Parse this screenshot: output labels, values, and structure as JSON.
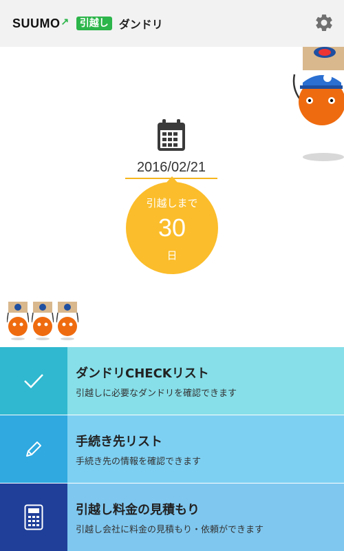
{
  "header": {
    "logo_suumo": "SUUMO",
    "logo_box": "引越し",
    "logo_text": "ダンドリ",
    "settings_icon": "gear-icon"
  },
  "countdown": {
    "date": "2016/02/21",
    "label": "引越しまで",
    "days": "30",
    "unit": "日"
  },
  "menu": [
    {
      "title": "ダンドリCHECKリスト",
      "subtitle": "引越しに必要なダンドリを確認できます",
      "icon": "check-icon",
      "icon_bg": "#2fb8cf",
      "bg": "#86dfe9"
    },
    {
      "title": "手続き先リスト",
      "subtitle": "手続き先の情報を確認できます",
      "icon": "pencil-icon",
      "icon_bg": "#2fa9e0",
      "bg": "#7ed0f2"
    },
    {
      "title": "引越し料金の見積もり",
      "subtitle": "引越し会社に料金の見積もり・依頼ができます",
      "icon": "calculator-icon",
      "icon_bg": "#1f3f99",
      "bg": "#7fc7ef"
    }
  ],
  "colors": {
    "accent": "#fbbd2b",
    "brand_green": "#2cb54a",
    "mascot_orange": "#ef6b0f"
  }
}
